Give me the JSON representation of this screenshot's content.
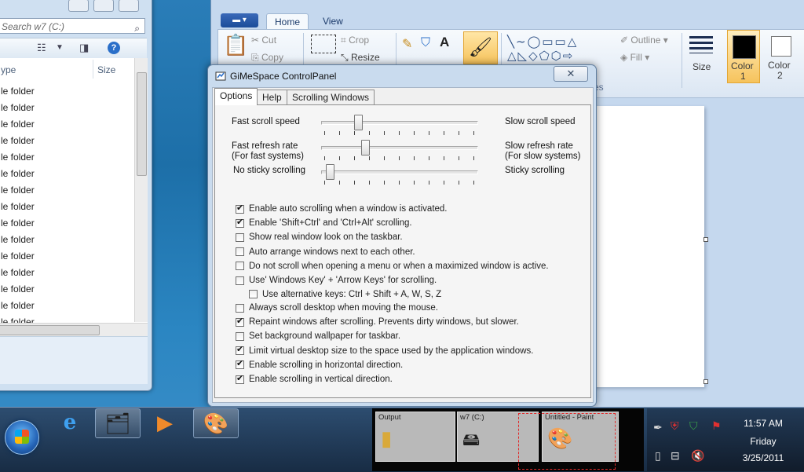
{
  "explorer": {
    "search_placeholder": "Search w7 (C:)",
    "col_type": "ype",
    "col_size": "Size",
    "rows": [
      "le folder",
      "le folder",
      "le folder",
      "le folder",
      "le folder",
      "le folder",
      "le folder",
      "le folder",
      "le folder",
      "le folder",
      "le folder",
      "le folder",
      "le folder",
      "le folder",
      "le folder"
    ]
  },
  "paint": {
    "title": "Untitled - Paint",
    "menu_label": "▬ ▾",
    "tabs": [
      "Home",
      "View"
    ],
    "ribbon": {
      "cut": "Cut",
      "copy": "Copy",
      "crop": "Crop",
      "resize": "Resize",
      "outline": "Outline",
      "fill": "Fill",
      "size": "Size",
      "color1": "Color",
      "color1_num": "1",
      "color2": "Color",
      "color2_num": "2",
      "group_shapes_tail": "es"
    }
  },
  "dialog": {
    "title": "GiMeSpace ControlPanel",
    "close_glyph": "✕",
    "tabs": [
      "Options",
      "Help",
      "Scrolling Windows"
    ],
    "active_tab": "Options",
    "sliders": [
      {
        "left": "Fast scroll speed",
        "right": "Slow scroll speed",
        "value": 0.22
      },
      {
        "left": "Fast refresh rate",
        "left2": "(For  fast systems)",
        "right": "Slow refresh rate",
        "right2": "(For slow systems)",
        "value": 0.27
      },
      {
        "left": "No sticky scrolling",
        "right": "Sticky scrolling",
        "value": 0.03
      }
    ],
    "options": [
      {
        "label": "Enable auto scrolling when a window is activated.",
        "checked": true
      },
      {
        "label": "Enable 'Shift+Ctrl' and 'Ctrl+Alt' scrolling.",
        "checked": true
      },
      {
        "label": "Show real window look on the taskbar.",
        "checked": false
      },
      {
        "label": "Auto arrange windows next to each other.",
        "checked": false
      },
      {
        "label": "Do not scroll when opening a menu or when a maximized window is active.",
        "checked": false
      },
      {
        "label": "Use' Windows Key' + 'Arrow Keys' for scrolling.",
        "checked": false
      },
      {
        "label": "Use alternative keys: Ctrl + Shift + A, W, S, Z",
        "checked": false,
        "indent": true
      },
      {
        "label": "Always scroll desktop when moving the mouse.",
        "checked": false
      },
      {
        "label": "Repaint windows after scrolling. Prevents dirty windows, but slower.",
        "checked": true
      },
      {
        "label": "Set background wallpaper for taskbar.",
        "checked": false
      },
      {
        "label": "Limit virtual desktop size to the space used by the application windows.",
        "checked": true
      },
      {
        "label": "Enable scrolling in horizontal direction.",
        "checked": true
      },
      {
        "label": "Enable scrolling in vertical direction.",
        "checked": true
      }
    ]
  },
  "taskbar": {
    "thumbnails": [
      {
        "caption": "Output"
      },
      {
        "caption": "w7 (C:)"
      },
      {
        "caption": "Untitled - Paint"
      }
    ],
    "clock": {
      "time": "11:57 AM",
      "day": "Friday",
      "date": "3/25/2011"
    }
  }
}
